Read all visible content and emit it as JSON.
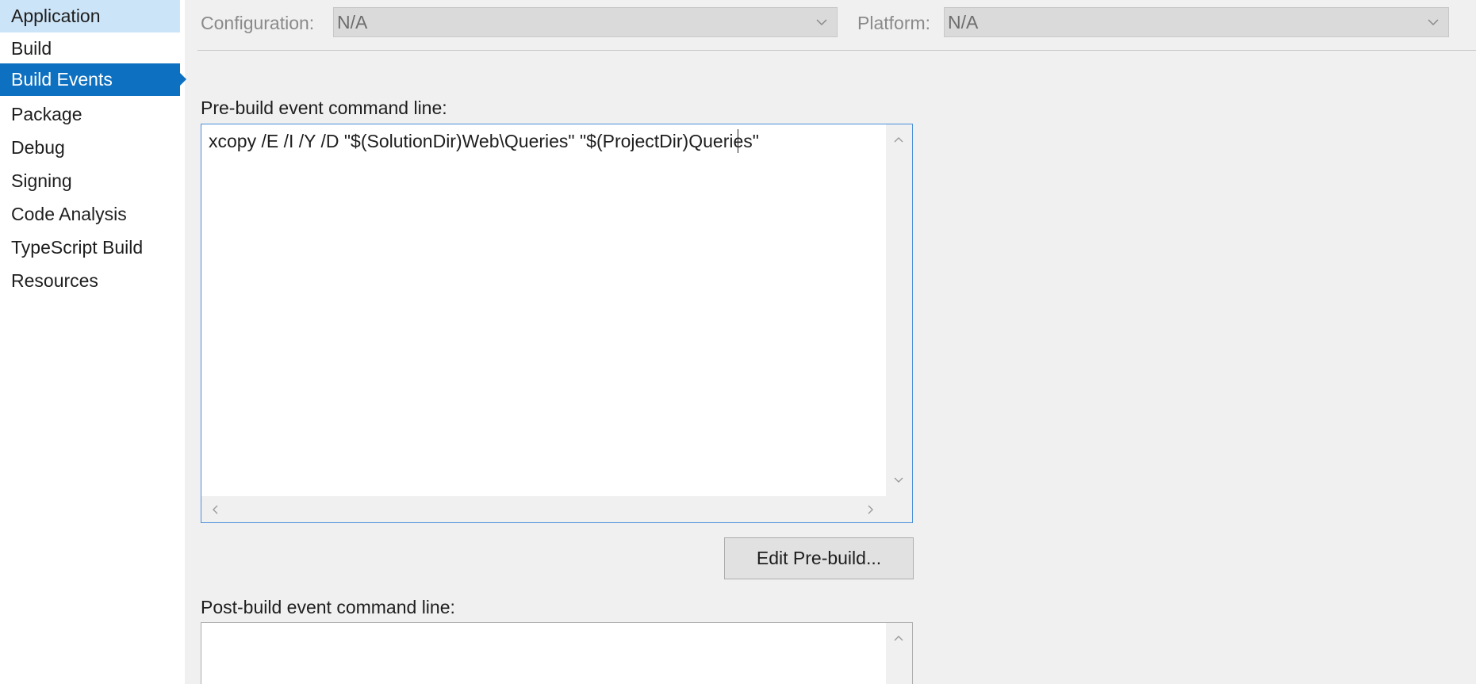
{
  "sidebar": {
    "items": [
      {
        "label": "Application"
      },
      {
        "label": "Build"
      },
      {
        "label": "Build Events"
      },
      {
        "label": "Package"
      },
      {
        "label": "Debug"
      },
      {
        "label": "Signing"
      },
      {
        "label": "Code Analysis"
      },
      {
        "label": "TypeScript Build"
      },
      {
        "label": "Resources"
      }
    ],
    "selected": "Build Events",
    "hovered": "Application"
  },
  "config_bar": {
    "configuration_label": "Configuration:",
    "configuration_value": "N/A",
    "platform_label": "Platform:",
    "platform_value": "N/A"
  },
  "pre_build": {
    "label": "Pre-build event command line:",
    "command": "xcopy /E /I /Y /D \"$(SolutionDir)Web\\Queries\" \"$(ProjectDir)Queries\"",
    "edit_button_label": "Edit Pre-build..."
  },
  "post_build": {
    "label": "Post-build event command line:",
    "command": ""
  },
  "colors": {
    "selected_bg": "#0e70c0",
    "hover_bg": "#cce4f7",
    "focus_border": "#4a90d9"
  },
  "icons": {
    "dropdown": "chevron-down-icon",
    "scroll_up": "scroll-up-arrow-icon",
    "scroll_down": "scroll-down-arrow-icon",
    "scroll_left": "scroll-left-arrow-icon",
    "scroll_right": "scroll-right-arrow-icon"
  }
}
